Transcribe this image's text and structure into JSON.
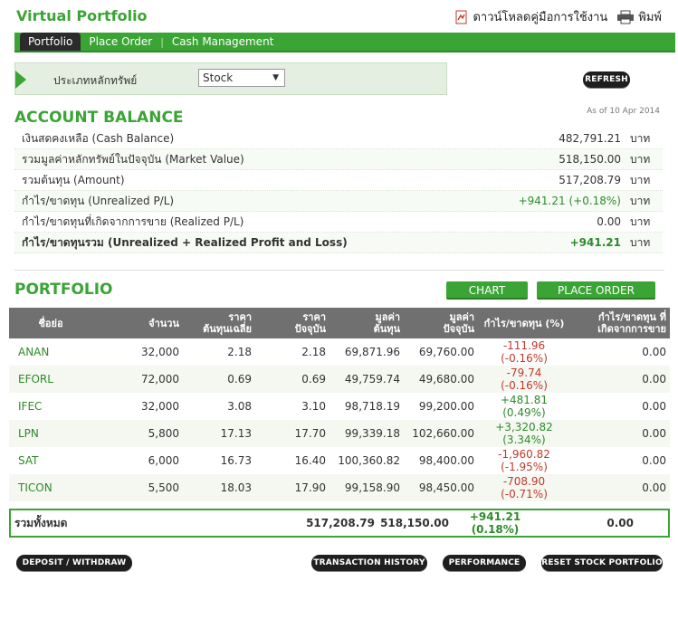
{
  "header": {
    "title": "Virtual Portfolio",
    "download_label": "ดาวน์โหลดคู่มือการใช้งาน",
    "print_label": "พิมพ์"
  },
  "nav": {
    "tabs": [
      {
        "label": "Portfolio",
        "active": true
      },
      {
        "label": "Place Order",
        "active": false
      },
      {
        "label": "Cash Management",
        "active": false
      }
    ]
  },
  "filter": {
    "label": "ประเภทหลักทรัพย์",
    "selected": "Stock"
  },
  "refresh_label": "REFRESH",
  "account": {
    "title": "ACCOUNT BALANCE",
    "as_of": "As of 10 Apr 2014",
    "unit": "บาท",
    "rows": [
      {
        "label": "เงินสดคงเหลือ (Cash Balance)",
        "value": "482,791.21"
      },
      {
        "label": "รวมมูลค่าหลักทรัพย์ในปัจจุบัน (Market Value)",
        "value": "518,150.00"
      },
      {
        "label": "รวมต้นทุน (Amount)",
        "value": "517,208.79"
      },
      {
        "label": "กำไร/ขาดทุน (Unrealized P/L)",
        "value": "+941.21 (+0.18%)"
      },
      {
        "label": "กำไร/ขาดทุนที่เกิดจากการขาย (Realized P/L)",
        "value": "0.00"
      },
      {
        "label": "กำไร/ขาดทุนรวม (Unrealized + Realized Profit and Loss)",
        "value": "+941.21"
      }
    ]
  },
  "portfolio": {
    "title": "PORTFOLIO",
    "chart_label": "CHART",
    "place_order_label": "PLACE ORDER",
    "columns": [
      [
        "ชื่อย่อ",
        ""
      ],
      [
        "จำนวน",
        ""
      ],
      [
        "ราคา",
        "ต้นทุนเฉลี่ย"
      ],
      [
        "ราคา",
        "ปัจจุบัน"
      ],
      [
        "มูลค่า",
        "ต้นทุน"
      ],
      [
        "มูลค่า",
        "ปัจจุบัน"
      ],
      [
        "กำไร/ขาดทุน (%)",
        ""
      ],
      [
        "กำไร/ขาดทุน ที่",
        "เกิดจากการขาย"
      ]
    ],
    "rows": [
      {
        "symbol": "ANAN",
        "qty": "32,000",
        "avg_cost": "2.18",
        "price": "2.18",
        "cost_value": "69,871.96",
        "market_value": "69,760.00",
        "pl": "-111.96",
        "pl_pct": "(-0.16%)",
        "realized": "0.00"
      },
      {
        "symbol": "EFORL",
        "qty": "72,000",
        "avg_cost": "0.69",
        "price": "0.69",
        "cost_value": "49,759.74",
        "market_value": "49,680.00",
        "pl": "-79.74",
        "pl_pct": "(-0.16%)",
        "realized": "0.00"
      },
      {
        "symbol": "IFEC",
        "qty": "32,000",
        "avg_cost": "3.08",
        "price": "3.10",
        "cost_value": "98,718.19",
        "market_value": "99,200.00",
        "pl": "+481.81",
        "pl_pct": "(0.49%)",
        "realized": "0.00"
      },
      {
        "symbol": "LPN",
        "qty": "5,800",
        "avg_cost": "17.13",
        "price": "17.70",
        "cost_value": "99,339.18",
        "market_value": "102,660.00",
        "pl": "+3,320.82",
        "pl_pct": "(3.34%)",
        "realized": "0.00"
      },
      {
        "symbol": "SAT",
        "qty": "6,000",
        "avg_cost": "16.73",
        "price": "16.40",
        "cost_value": "100,360.82",
        "market_value": "98,400.00",
        "pl": "-1,960.82",
        "pl_pct": "(-1.95%)",
        "realized": "0.00"
      },
      {
        "symbol": "TICON",
        "qty": "5,500",
        "avg_cost": "18.03",
        "price": "17.90",
        "cost_value": "99,158.90",
        "market_value": "98,450.00",
        "pl": "-708.90",
        "pl_pct": "(-0.71%)",
        "realized": "0.00"
      }
    ],
    "total": {
      "label": "รวมทั้งหมด",
      "cost_value": "517,208.79",
      "market_value": "518,150.00",
      "pl": "+941.21",
      "pl_pct": "(0.18%)",
      "realized": "0.00"
    }
  },
  "footer_buttons": {
    "deposit": "DEPOSIT / WITHDRAW",
    "history": "TRANSACTION HISTORY",
    "performance": "PERFORMANCE",
    "reset": "RESET STOCK PORTFOLIO"
  },
  "colors": {
    "brand_green": "#3aa535",
    "loss_red": "#c0392b",
    "header_gray": "#707070"
  }
}
